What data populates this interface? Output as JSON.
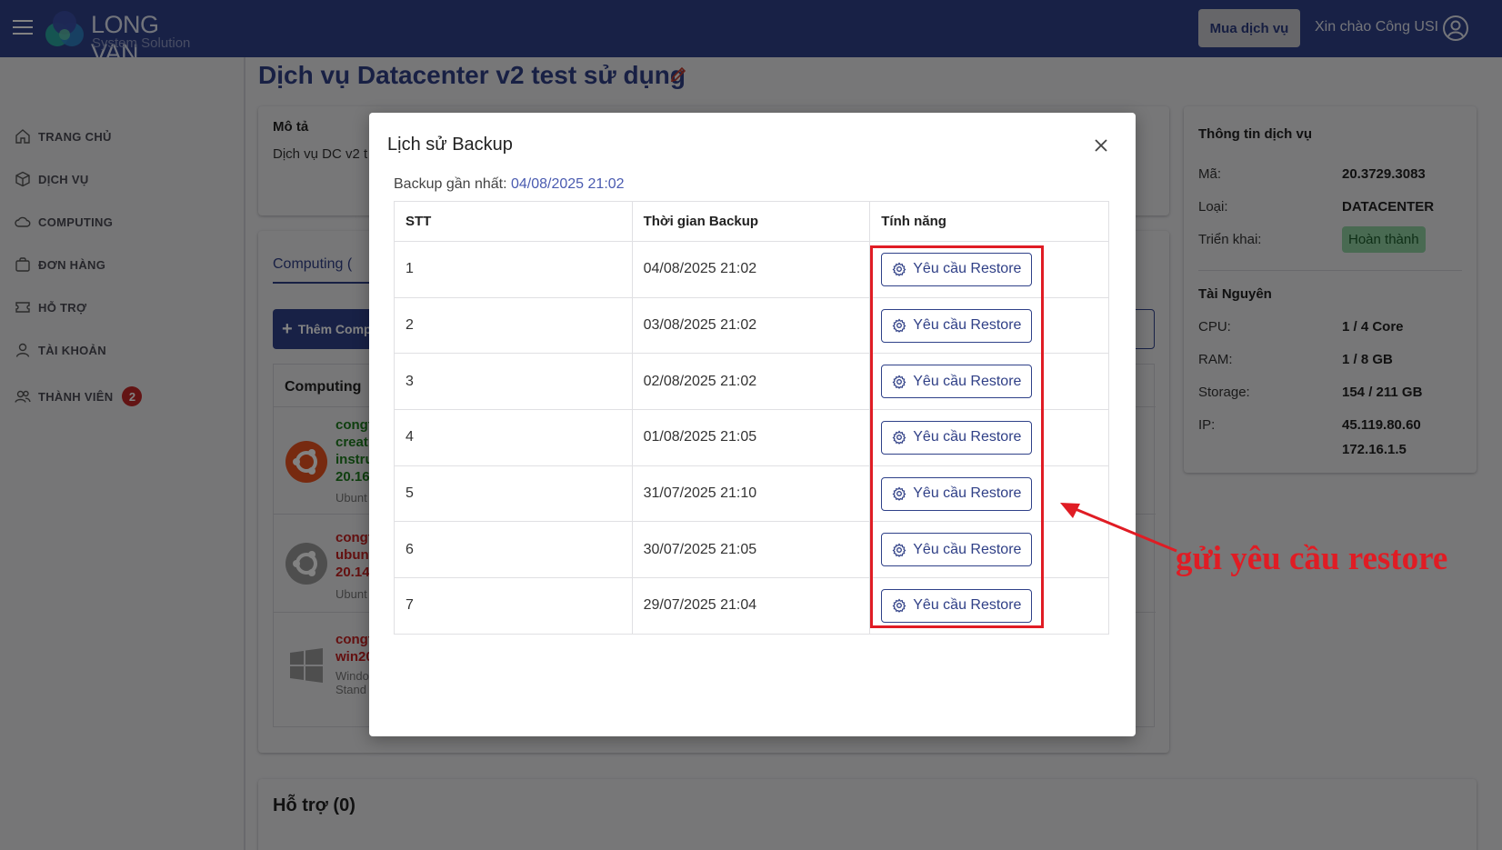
{
  "header": {
    "logo_title": "LONG VAN",
    "logo_subtitle": "System Solution",
    "buy_button": "Mua dịch vụ",
    "greeting": "Xin chào Công USI"
  },
  "sidebar": {
    "items": [
      {
        "label": "TRANG CHỦ",
        "icon": "home-icon"
      },
      {
        "label": "DỊCH VỤ",
        "icon": "cube-icon"
      },
      {
        "label": "COMPUTING",
        "icon": "cloud-icon"
      },
      {
        "label": "ĐƠN HÀNG",
        "icon": "bag-icon"
      },
      {
        "label": "HỖ TRỢ",
        "icon": "ticket-icon"
      },
      {
        "label": "TÀI KHOẢN",
        "icon": "person-icon"
      },
      {
        "label": "THÀNH VIÊN",
        "icon": "group-icon",
        "badge": "2"
      }
    ]
  },
  "page": {
    "title": "Dịch vụ Datacenter v2 test sử dụng",
    "desc_label": "Mô tả",
    "desc_text": "Dịch vụ DC v2 t",
    "tab_computing": "Computing (",
    "add_button": "Thêm Comp",
    "computing_header": "Computing",
    "vms": [
      {
        "name": [
          "congt",
          "creat",
          "instru",
          "20.16"
        ],
        "os": [
          "Ubunt"
        ],
        "color": "#1e7d1e",
        "icon": "ubuntu-icon"
      },
      {
        "name": [
          "congt",
          "ubunt",
          "20.14"
        ],
        "os": [
          "Ubunt"
        ],
        "color": "#c42020",
        "icon": "ubuntu-icon"
      },
      {
        "name": [
          "congt",
          "win20"
        ],
        "os": [
          "Windo",
          "Stand"
        ],
        "color": "#c42020",
        "icon": "windows-icon"
      }
    ],
    "support_title": "Hỗ trợ (0)"
  },
  "service_info": {
    "title": "Thông tin dịch vụ",
    "code_label": "Mã:",
    "code_value": "20.3729.3083",
    "type_label": "Loại:",
    "type_value": "DATACENTER",
    "deploy_label": "Triển khai:",
    "deploy_value": "Hoàn thành",
    "resources_title": "Tài Nguyên",
    "cpu_label": "CPU:",
    "cpu_value": "1 / 4 Core",
    "ram_label": "RAM:",
    "ram_value": "1 / 8 GB",
    "storage_label": "Storage:",
    "storage_value": "154 / 211 GB",
    "ip_label": "IP:",
    "ip_values": [
      "45.119.80.60",
      "172.16.1.5"
    ]
  },
  "modal": {
    "title": "Lịch sử Backup",
    "latest_label": "Backup gần nhất:",
    "latest_value": "04/08/2025 21:02",
    "columns": [
      "STT",
      "Thời gian Backup",
      "Tính năng"
    ],
    "rows": [
      {
        "stt": "1",
        "time": "04/08/2025 21:02",
        "action": "Yêu cầu Restore"
      },
      {
        "stt": "2",
        "time": "03/08/2025 21:02",
        "action": "Yêu cầu Restore"
      },
      {
        "stt": "3",
        "time": "02/08/2025 21:02",
        "action": "Yêu cầu Restore"
      },
      {
        "stt": "4",
        "time": "01/08/2025 21:05",
        "action": "Yêu cầu Restore"
      },
      {
        "stt": "5",
        "time": "31/07/2025 21:10",
        "action": "Yêu cầu Restore"
      },
      {
        "stt": "6",
        "time": "30/07/2025 21:05",
        "action": "Yêu cầu Restore"
      },
      {
        "stt": "7",
        "time": "29/07/2025 21:04",
        "action": "Yêu cầu Restore"
      }
    ]
  },
  "annotation": {
    "text": "gửi yêu cầu restore",
    "color": "#e01c24"
  },
  "colors": {
    "primary": "#2f4189",
    "success_bg": "#8fd0a1",
    "badge": "#c32828"
  }
}
